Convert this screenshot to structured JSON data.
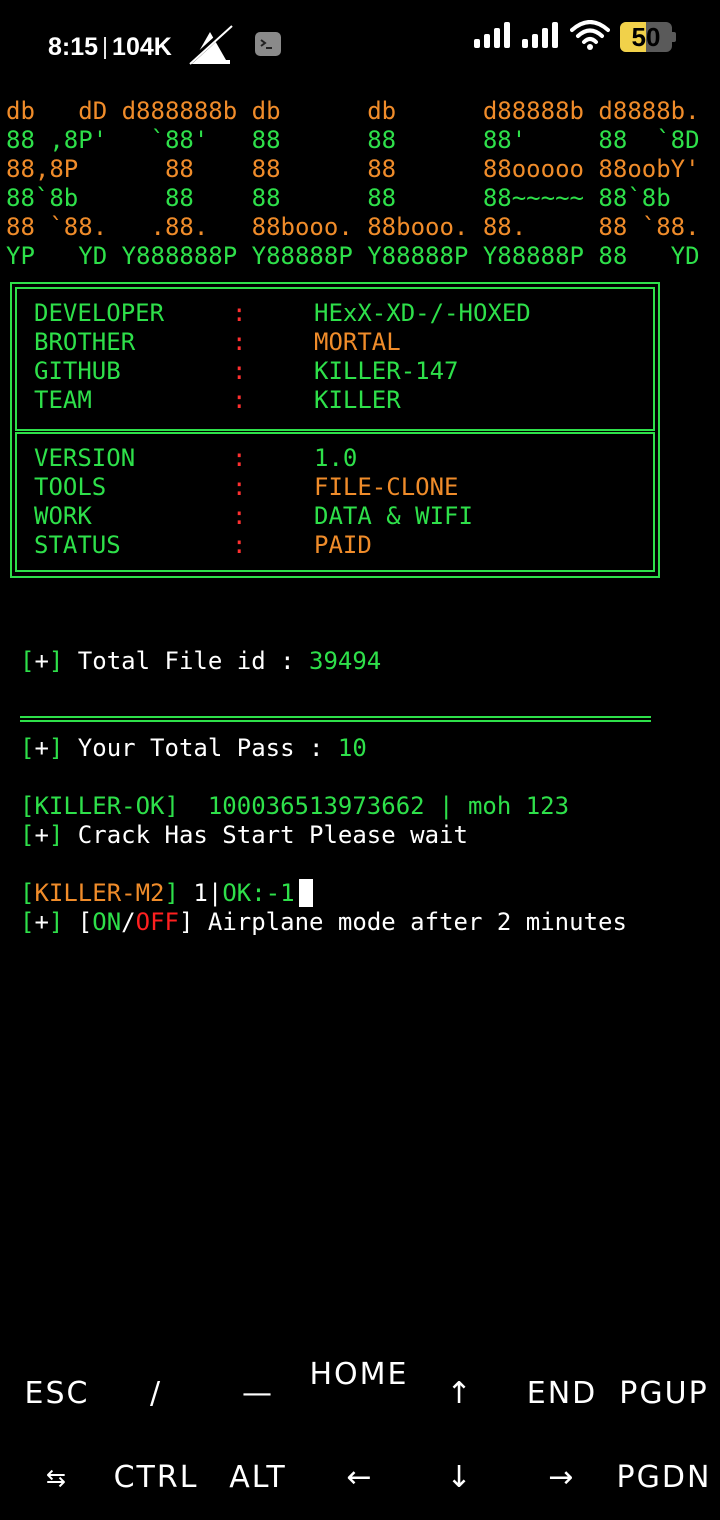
{
  "status_bar": {
    "time": "8:15",
    "net_speed": "104K",
    "battery": "50",
    "battery_fraction": 0.5,
    "icons": [
      "no-notification-icon",
      "terminal-app-icon",
      "signal-icon",
      "signal-icon-2",
      "wifi-icon",
      "battery-icon"
    ]
  },
  "banner": [
    [
      {
        "t": "db   dD d888888b db      db      d88888b d8888b.",
        "c": "o"
      }
    ],
    [
      {
        "t": "88 ,8P'   `88'   88      88      88'     88  `8D",
        "c": "g"
      }
    ],
    [
      {
        "t": "88,8P      88    88      88      88ooooo 88oobY'",
        "c": "o"
      }
    ],
    [
      {
        "t": "88`8b      88    88      88      88~~~~~ 88`8b",
        "c": "g"
      }
    ],
    [
      {
        "t": "88 `88.   .88.   88booo. 88booo. 88.     88 `88.",
        "c": "o"
      }
    ],
    [
      {
        "t": "YP   YD Y888888P Y88888P Y88888P Y88888P 88   YD",
        "c": "g"
      }
    ]
  ],
  "info_top": [
    {
      "key": "DEVELOPER",
      "sep": ":",
      "value": "HExX-XD-/-HOXED",
      "color": "g"
    },
    {
      "key": "BROTHER",
      "sep": ":",
      "value": "MORTAL",
      "color": "o"
    },
    {
      "key": "GITHUB",
      "sep": ":",
      "value": "KILLER-147",
      "color": "g"
    },
    {
      "key": "TEAM",
      "sep": ":",
      "value": "KILLER",
      "color": "g"
    }
  ],
  "info_bottom": [
    {
      "key": "VERSION",
      "sep": ":",
      "value": "1.0",
      "color": "g"
    },
    {
      "key": "TOOLS",
      "sep": ":",
      "value": "FILE-CLONE",
      "color": "o"
    },
    {
      "key": "WORK",
      "sep": ":",
      "value": "DATA & WIFI",
      "color": "g"
    },
    {
      "key": "STATUS",
      "sep": ":",
      "value": "PAID",
      "color": "o"
    }
  ],
  "progress": {
    "bracket_open": "[",
    "plus": "+",
    "bracket_close": "]",
    "total_file_label": " Total File id : ",
    "total_file_value": "39494",
    "total_pass_label": " Your Total Pass : ",
    "total_pass_value": "10",
    "crack_msg": " Crack Has Start Please wait",
    "airplane_pre": " [",
    "on": "ON",
    "slash": "/",
    "off": "OFF",
    "airplane_post": "] Airplane mode after 2 minutes"
  },
  "results": {
    "ok_tag": "[KILLER-OK]",
    "ok_text": "  100036513973662 | moh 123",
    "m2_tag": "[KILLER-M2]",
    "m2_count": " 1",
    "m2_sep": "|",
    "m2_status": "OK:-1"
  },
  "extra_keys": {
    "row1": [
      "ESC",
      "/",
      "—",
      "HOME",
      "↑",
      "END",
      "PGUP"
    ],
    "row2": [
      "⇆",
      "CTRL",
      "ALT",
      "←",
      "↓",
      "→",
      "PGDN"
    ]
  },
  "colors": {
    "green": "#2ee04a",
    "orange": "#f08c2a",
    "red": "#ff2020",
    "background": "#000000",
    "battery": "#f1d14a"
  }
}
